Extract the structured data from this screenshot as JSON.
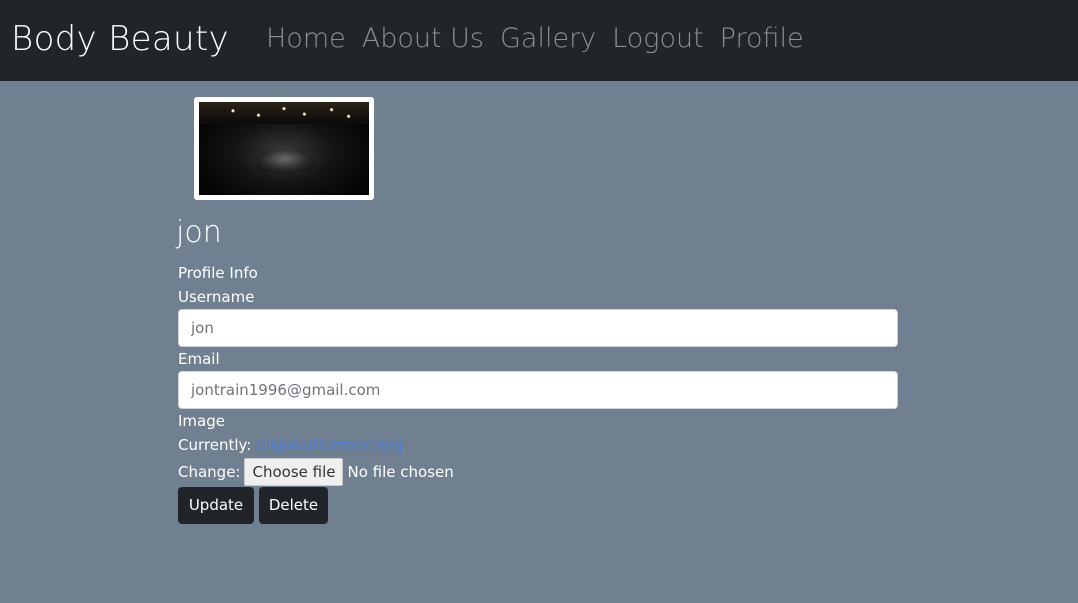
{
  "nav": {
    "brand": "Body Beauty",
    "links": [
      "Home",
      "About Us",
      "Gallery",
      "Logout",
      "Profile"
    ]
  },
  "profile": {
    "name": "jon",
    "section_label": "Profile Info",
    "username_label": "Username",
    "username_value": "jon",
    "email_label": "Email",
    "email_value": "jontrain1996@gmail.com",
    "image_label": "Image",
    "currently_label": "Currently:",
    "currently_file": "dlkjwkufterroecjnjnj",
    "change_label": "Change:",
    "choose_file_label": "Choose file",
    "no_file_text": "No file chosen"
  },
  "actions": {
    "update_label": "Update",
    "delete_label": "Delete"
  },
  "colors": {
    "navbar_bg": "#212529",
    "page_bg": "#708090",
    "button_bg": "#212529",
    "link": "#4d7dd6"
  }
}
